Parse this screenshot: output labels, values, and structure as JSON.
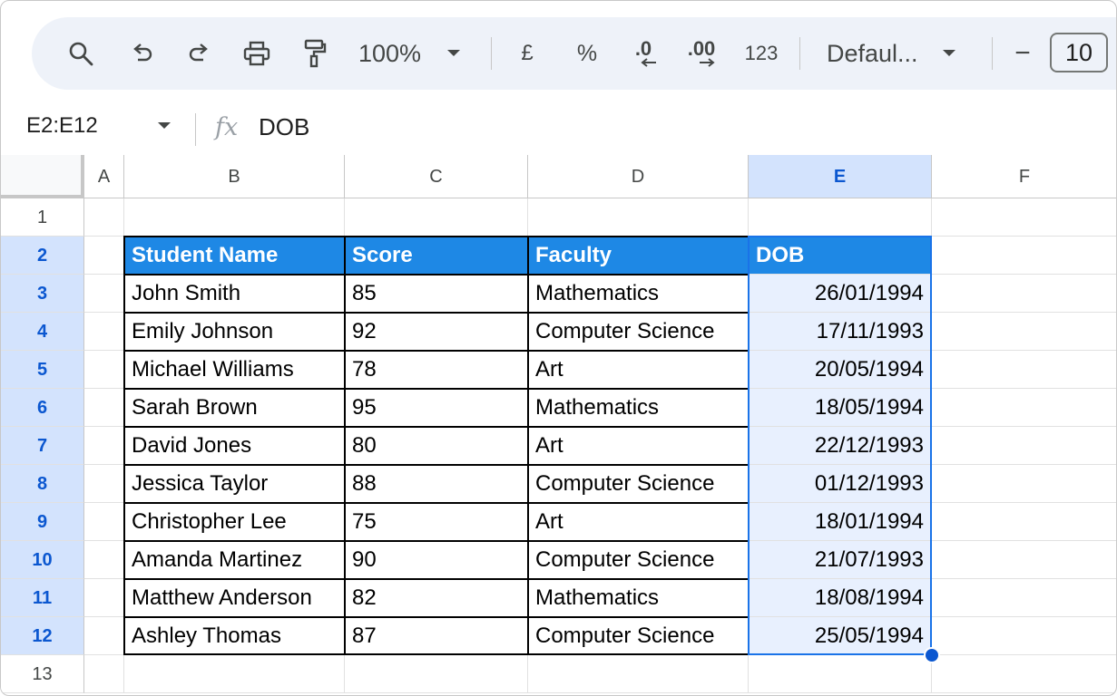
{
  "toolbar": {
    "zoom": "100%",
    "currency_label": "£",
    "percent_label": "%",
    "decrease_decimal_label": ".0",
    "increase_decimal_label": ".00",
    "number_format_label": "123",
    "font_family": "Defaul...",
    "decrease_font_label": "−",
    "font_size": "10"
  },
  "formula_bar": {
    "name_box": "E2:E12",
    "fx_label": "fx",
    "formula": "DOB"
  },
  "columns": [
    "A",
    "B",
    "C",
    "D",
    "E",
    "F"
  ],
  "rows": [
    "1",
    "2",
    "3",
    "4",
    "5",
    "6",
    "7",
    "8",
    "9",
    "10",
    "11",
    "12",
    "13"
  ],
  "table": {
    "headers": [
      "Student Name",
      "Score",
      "Faculty",
      "DOB"
    ],
    "rows": [
      [
        "John Smith",
        "85",
        "Mathematics",
        "26/01/1994"
      ],
      [
        "Emily Johnson",
        "92",
        "Computer Science",
        "17/11/1993"
      ],
      [
        "Michael Williams",
        "78",
        "Art",
        "20/05/1994"
      ],
      [
        "Sarah Brown",
        "95",
        "Mathematics",
        "18/05/1994"
      ],
      [
        "David Jones",
        "80",
        "Art",
        "22/12/1993"
      ],
      [
        "Jessica Taylor",
        "88",
        "Computer Science",
        "01/12/1993"
      ],
      [
        "Christopher Lee",
        "75",
        "Art",
        "18/01/1994"
      ],
      [
        "Amanda Martinez",
        "90",
        "Computer Science",
        "21/07/1993"
      ],
      [
        "Matthew Anderson",
        "82",
        "Mathematics",
        "18/08/1994"
      ],
      [
        "Ashley Thomas",
        "87",
        "Computer Science",
        "25/05/1994"
      ]
    ]
  },
  "colors": {
    "header_fill": "#1e88e5",
    "selection": "#1a73e8",
    "selection_fill": "#e8f0fe"
  }
}
